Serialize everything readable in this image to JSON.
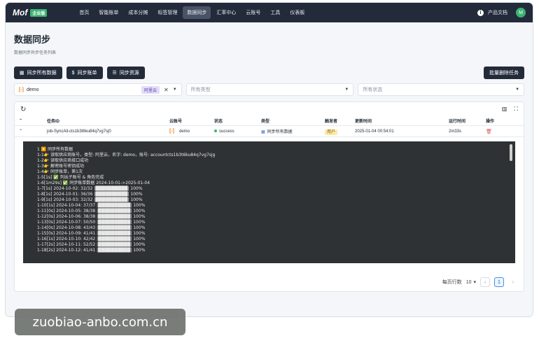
{
  "app": {
    "logo_text": "Mof",
    "logo_badge": "企业版",
    "nav": [
      "首页",
      "智能账单",
      "成本分摊",
      "标签管理",
      "数据同步",
      "汇率中心",
      "云账号",
      "工具",
      "仪表板"
    ],
    "active_nav_index": 4,
    "docs_label": "产品文档",
    "avatar_letter": "M"
  },
  "page": {
    "title": "数据同步",
    "subtitle": "数据同步异步任务列表"
  },
  "actions": {
    "sync_all": "同步所有数据",
    "sync_bills": "同步账单",
    "sync_resources": "同步资源",
    "batch_delete": "批量删除任务"
  },
  "filters": {
    "account_value": "demo",
    "account_provider": "阿里云",
    "type_placeholder": "所有类型",
    "status_placeholder": "所有状态"
  },
  "table": {
    "headers": [
      "任务ID",
      "云账号",
      "状态",
      "类型",
      "触发者",
      "更新时间",
      "运行时间",
      "操作"
    ],
    "rows": [
      {
        "id": "job-SyncAll-cts1b3t6ku84q7vg7sj0",
        "account": "demo",
        "status": "success",
        "type": "同步所有数据",
        "trigger": "用户",
        "updated": "2025-01-04 00:54:01",
        "duration": "2m33s"
      }
    ]
  },
  "log_lines": [
    "1      ▶️ 同步所有数据",
    "1-1👉 读取供应商账号，类型: 阿里云，名字: demo，账号: accountcts1b3t6ku84q7vg7sjg",
    "1-2👉 读取供应商接口成功",
    "1-3👉 解密账号密钥成功",
    "1-4👉 同步账单，第1次",
    "1-5[1s] ✅ 列出子账号 & 角色完成",
    "1-6[1m29s] ✅ 同步账单数据 2024-10-01->2025-01-04",
    "1-7[1s] 2024-10-02: 32/32 |██████████| 100%",
    "1-8[1s] 2024-10-01: 36/36 |██████████| 100%",
    "1-9[1s] 2024-10-03: 32/32 |██████████| 100%",
    "1-10[1s] 2024-10-04: 37/37 |██████████| 100%",
    "1-11[0s] 2024-10-05: 38/38 |██████████| 100%",
    "1-12[0s] 2024-10-06: 38/38 |██████████| 100%",
    "1-13[0s] 2024-10-07: 50/50 |██████████| 100%",
    "1-14[0s] 2024-10-08: 43/43 |██████████| 100%",
    "1-15[0s] 2024-10-09: 41/41 |██████████| 100%",
    "1-16[1s] 2024-10-10: 42/42 |██████████| 100%",
    "1-17[2s] 2024-10-11: 52/52 |██████████| 100%",
    "1-18[2s] 2024-10-12: 41/41 |██████████| 100%"
  ],
  "pager": {
    "rows_per_page_label": "每页行数",
    "rows_per_page": "10",
    "current_page": "1"
  },
  "watermark": "zuobiao-anbo.com.cn"
}
